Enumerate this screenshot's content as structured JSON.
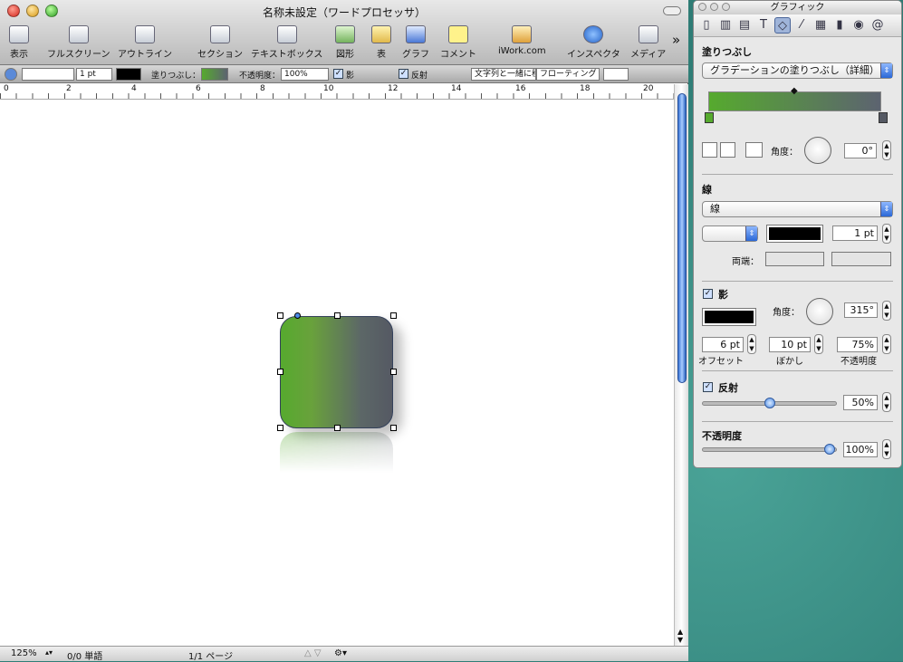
{
  "window": {
    "title": "名称未設定（ワードプロセッサ）"
  },
  "toolbar": {
    "items": [
      {
        "label": "表示",
        "icon": "view-icon"
      },
      {
        "label": "フルスクリーン",
        "icon": "fullscreen-icon"
      },
      {
        "label": "アウトライン",
        "icon": "outline-icon"
      },
      {
        "label": "セクション",
        "icon": "section-icon"
      },
      {
        "label": "テキストボックス",
        "icon": "textbox-icon"
      },
      {
        "label": "図形",
        "icon": "shape-icon"
      },
      {
        "label": "表",
        "icon": "table-icon"
      },
      {
        "label": "グラフ",
        "icon": "chart-icon"
      },
      {
        "label": "コメント",
        "icon": "comment-icon"
      },
      {
        "label": "iWork.com",
        "icon": "iwork-icon"
      },
      {
        "label": "インスペクタ",
        "icon": "inspector-icon"
      },
      {
        "label": "メディア",
        "icon": "media-icon"
      }
    ],
    "overflow": "»"
  },
  "format_bar": {
    "line_width": "1 pt",
    "fill_label": "塗りつぶし：",
    "opacity_label": "不透明度：",
    "opacity_value": "100%",
    "shadow_label": "影",
    "reflection_label": "反射",
    "wrap_label": "文字列と一緒に移",
    "floating_label": "フローティング"
  },
  "ruler": {
    "marks": [
      "0",
      "2",
      "4",
      "6",
      "8",
      "10",
      "12",
      "14",
      "16",
      "18",
      "20"
    ]
  },
  "status": {
    "zoom": "125%",
    "words": "0/0 単語",
    "pages": "1/1 ページ"
  },
  "inspector": {
    "title": "グラフィック",
    "fill_section": "塗りつぶし",
    "fill_type": "グラデーションの塗りつぶし（詳細）",
    "angle_label": "角度：",
    "fill_angle": "0°",
    "stroke_section": "線",
    "stroke_type": "線",
    "stroke_width": "1 pt",
    "endpoints_label": "両端：",
    "shadow_label": "影",
    "shadow_angle_label": "角度：",
    "shadow_angle": "315°",
    "offset_value": "6 pt",
    "blur_value": "10 pt",
    "shadow_opacity": "75%",
    "offset_label": "オフセット",
    "blur_label": "ぼかし",
    "shadow_opacity_label": "不透明度",
    "reflection_label": "反射",
    "reflection_value": "50%",
    "opacity_section": "不透明度",
    "opacity_value": "100%"
  }
}
